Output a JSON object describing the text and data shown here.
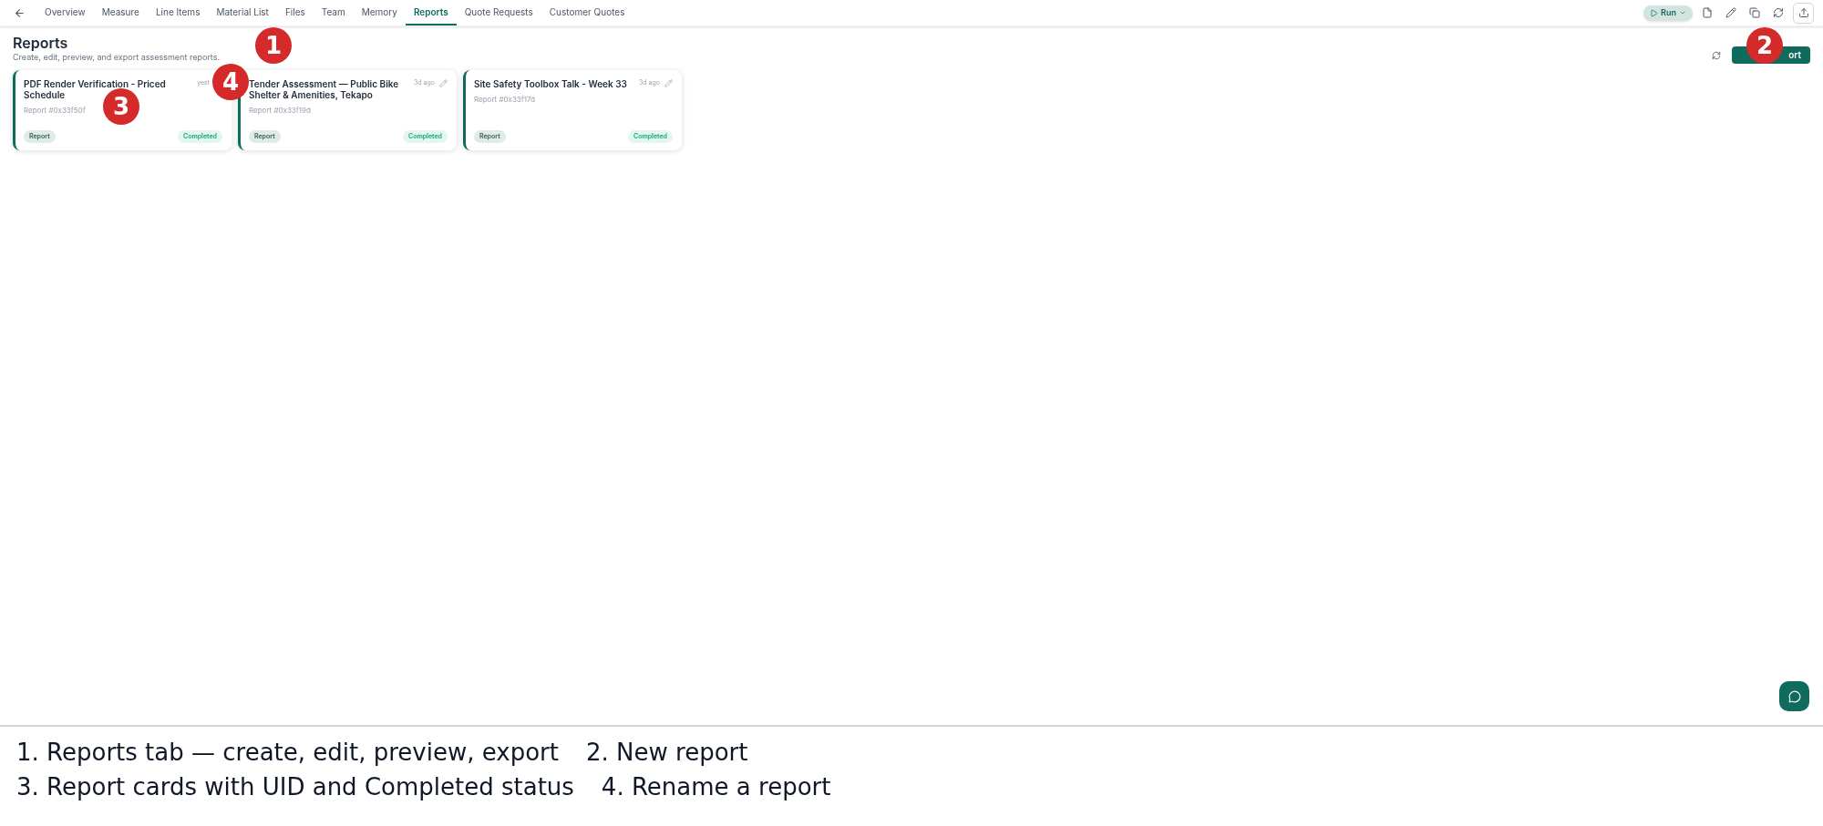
{
  "tabs": [
    {
      "label": "Overview",
      "selected": false
    },
    {
      "label": "Measure",
      "selected": false
    },
    {
      "label": "Line Items",
      "selected": false
    },
    {
      "label": "Material List",
      "selected": false
    },
    {
      "label": "Files",
      "selected": false
    },
    {
      "label": "Team",
      "selected": false
    },
    {
      "label": "Memory",
      "selected": false
    },
    {
      "label": "Reports",
      "selected": true
    },
    {
      "label": "Quote Requests",
      "selected": false
    },
    {
      "label": "Customer Quotes",
      "selected": false
    }
  ],
  "run_button": {
    "label": "Run"
  },
  "header": {
    "title": "Reports",
    "subtitle": "Create, edit, preview, and export assessment reports."
  },
  "new_button": {
    "label": "ort"
  },
  "cards": [
    {
      "title": "PDF Render Verification - Priced Schedule",
      "uid": "Report #0x33f50f",
      "time": "yest",
      "rename_icon": false,
      "tag": "Report",
      "status": "Completed"
    },
    {
      "title": "Tender Assessment — Public Bike Shelter & Amenities, Tekapo",
      "uid": "Report #0x33f19d",
      "time": "3d ago",
      "rename_icon": true,
      "tag": "Report",
      "status": "Completed"
    },
    {
      "title": "Site Safety Toolbox Talk - Week 33",
      "uid": "Report #0x33f17d",
      "time": "3d ago",
      "rename_icon": true,
      "tag": "Report",
      "status": "Completed"
    }
  ],
  "markers": [
    {
      "label": "1"
    },
    {
      "label": "2"
    },
    {
      "label": "3"
    },
    {
      "label": "4"
    }
  ],
  "legend": [
    [
      "1. Reports tab — create, edit, preview, export",
      "2. New report"
    ],
    [
      "3. Report cards with UID and Completed status",
      "4. Rename a report"
    ]
  ]
}
